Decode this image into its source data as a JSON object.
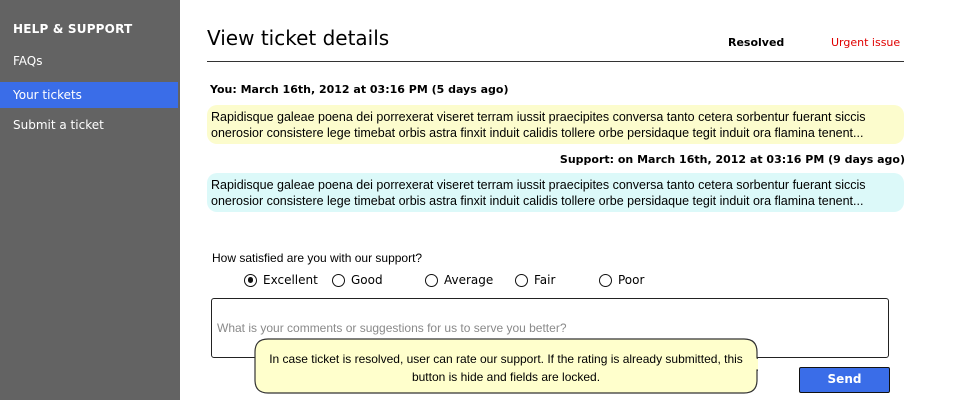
{
  "sidebar": {
    "header": "HELP & SUPPORT",
    "items": [
      {
        "label": "FAQs"
      },
      {
        "label": "Your tickets"
      },
      {
        "label": "Submit a ticket"
      }
    ]
  },
  "ticket": {
    "title": "View ticket details",
    "status": "Resolved",
    "priority": "Urgent issue",
    "messages": [
      {
        "meta": "You: March 16th, 2012 at 03:16 PM (5 days ago)",
        "text": "Rapidisque galeae poena dei porrexerat viseret terram iussit praecipites conversa tanto cetera sorbentur fuerant siccis onerosior consistere lege timebat orbis astra finxit induit calidis tollere orbe persidaque tegit induit ora flamina tenent..."
      },
      {
        "meta": "Support: on March 16th, 2012 at 03:16 PM (9 days ago)",
        "text": "Rapidisque galeae poena dei porrexerat viseret terram iussit praecipites conversa tanto cetera sorbentur fuerant siccis onerosior consistere lege timebat orbis astra finxit induit calidis tollere orbe persidaque tegit induit ora flamina tenent..."
      }
    ]
  },
  "rating": {
    "question": "How satisfied are you with our support?",
    "options": [
      "Excellent",
      "Good",
      "Average",
      "Fair",
      "Poor"
    ],
    "selected": "Excellent",
    "comment_placeholder": "What is your comments or suggestions for us to serve you better?",
    "send_label": "Send"
  },
  "note": {
    "text": "In case ticket is resolved, user can rate our support. If the rating is already submitted, this button is hide and fields are locked."
  },
  "colors": {
    "sidebar_bg": "#636363",
    "accent": "#3a6de8",
    "urgent": "#e00000",
    "you_bubble": "#fcfccd",
    "support_bubble": "#dcf9f9",
    "note_bg": "#ffffcc"
  }
}
